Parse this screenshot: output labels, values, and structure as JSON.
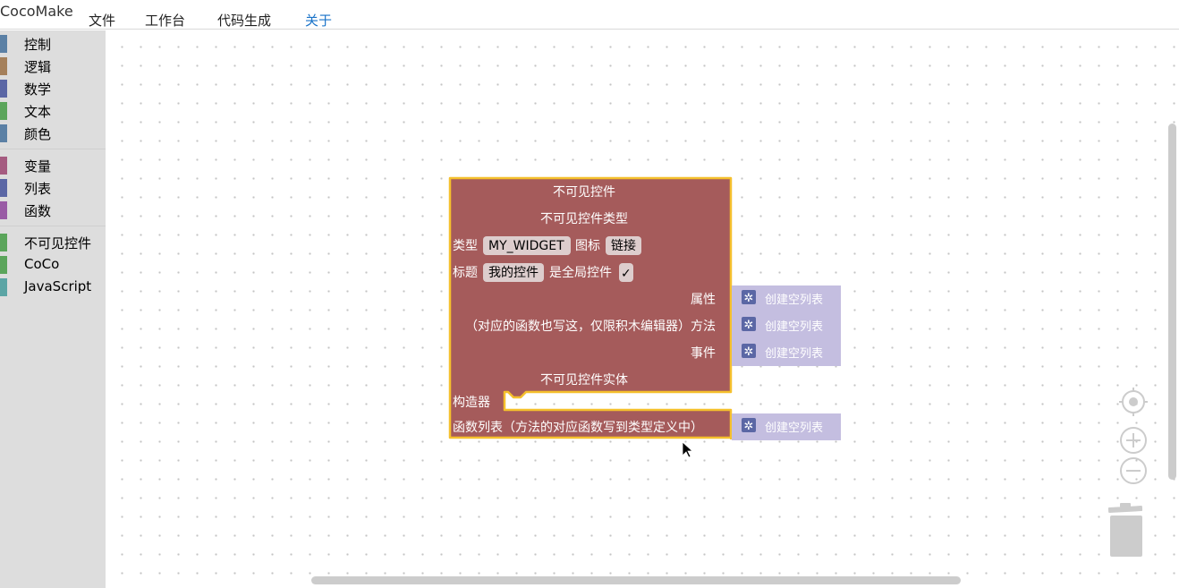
{
  "app": {
    "title": "CocoMake"
  },
  "menu": [
    {
      "label": "文件"
    },
    {
      "label": "工作台"
    },
    {
      "label": "代码生成"
    },
    {
      "label": "关于"
    }
  ],
  "toolbox": {
    "categories": [
      {
        "label": "控制",
        "color": "#5b80a5"
      },
      {
        "label": "逻辑",
        "color": "#a5805b"
      },
      {
        "label": "数学",
        "color": "#5b67a5"
      },
      {
        "label": "文本",
        "color": "#5ba55b"
      },
      {
        "label": "颜色",
        "color": "#5b80a5"
      },
      {
        "label": "变量",
        "color": "#a55b80"
      },
      {
        "label": "列表",
        "color": "#5b67a5"
      },
      {
        "label": "函数",
        "color": "#995ba5"
      },
      {
        "label": "不可见控件",
        "color": "#5ba55b"
      },
      {
        "label": "CoCo",
        "color": "#5ba55b"
      },
      {
        "label": "JavaScript",
        "color": "#5ba5a5"
      }
    ]
  },
  "block": {
    "color": "#a55b5b",
    "border_color": "#f5c02d",
    "title": "不可见控件",
    "section_type": "不可见控件类型",
    "type_label": "类型",
    "type_value": "MY_WIDGET",
    "icon_label": "图标",
    "icon_value": "链接",
    "title_label": "标题",
    "title_value": "我的控件",
    "global_label": "是全局控件",
    "global_checked": "✓",
    "props_label": "属性",
    "methods_note": "（对应的函数也写这，仅限积木编辑器）方法",
    "events_label": "事件",
    "section_entity": "不可见控件实体",
    "constructor_label": "构造器",
    "funclist_label": "函数列表（方法的对应函数写到类型定义中）"
  },
  "list_block": {
    "label": "创建空列表",
    "color": "#c4bee0",
    "gear_color": "#5b67a5"
  }
}
